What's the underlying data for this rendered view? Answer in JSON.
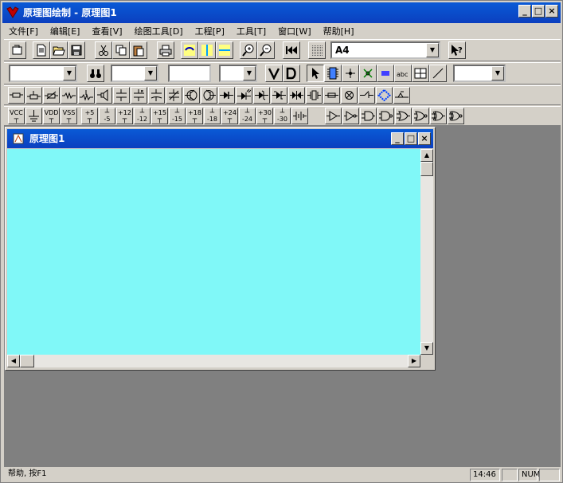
{
  "app": {
    "title": "原理图绘制 - 原理图1"
  },
  "menu": [
    "文件[F]",
    "编辑[E]",
    "查看[V]",
    "绘图工具[D]",
    "工程[P]",
    "工具[T]",
    "窗口[W]",
    "帮助[H]"
  ],
  "toolbar": {
    "paper_size": "A4"
  },
  "symbols": {
    "vcc": "VCC",
    "vdd": "VDD",
    "vss": "VSS",
    "p5": "+5",
    "m5": "-5",
    "p12": "+12",
    "m12": "-12",
    "p15": "+15",
    "m15": "-15",
    "p18": "+18",
    "m18": "-18",
    "p24": "+24",
    "m24": "-24",
    "p30": "+30",
    "m30": "-30"
  },
  "child": {
    "title": "原理图1"
  },
  "status": {
    "help": "帮助, 按F1",
    "time": "14:46",
    "num": "NUM"
  },
  "colors": {
    "canvas": "#80f8f8",
    "titlebar": "#0a4fd0",
    "workspace": "#808080"
  }
}
